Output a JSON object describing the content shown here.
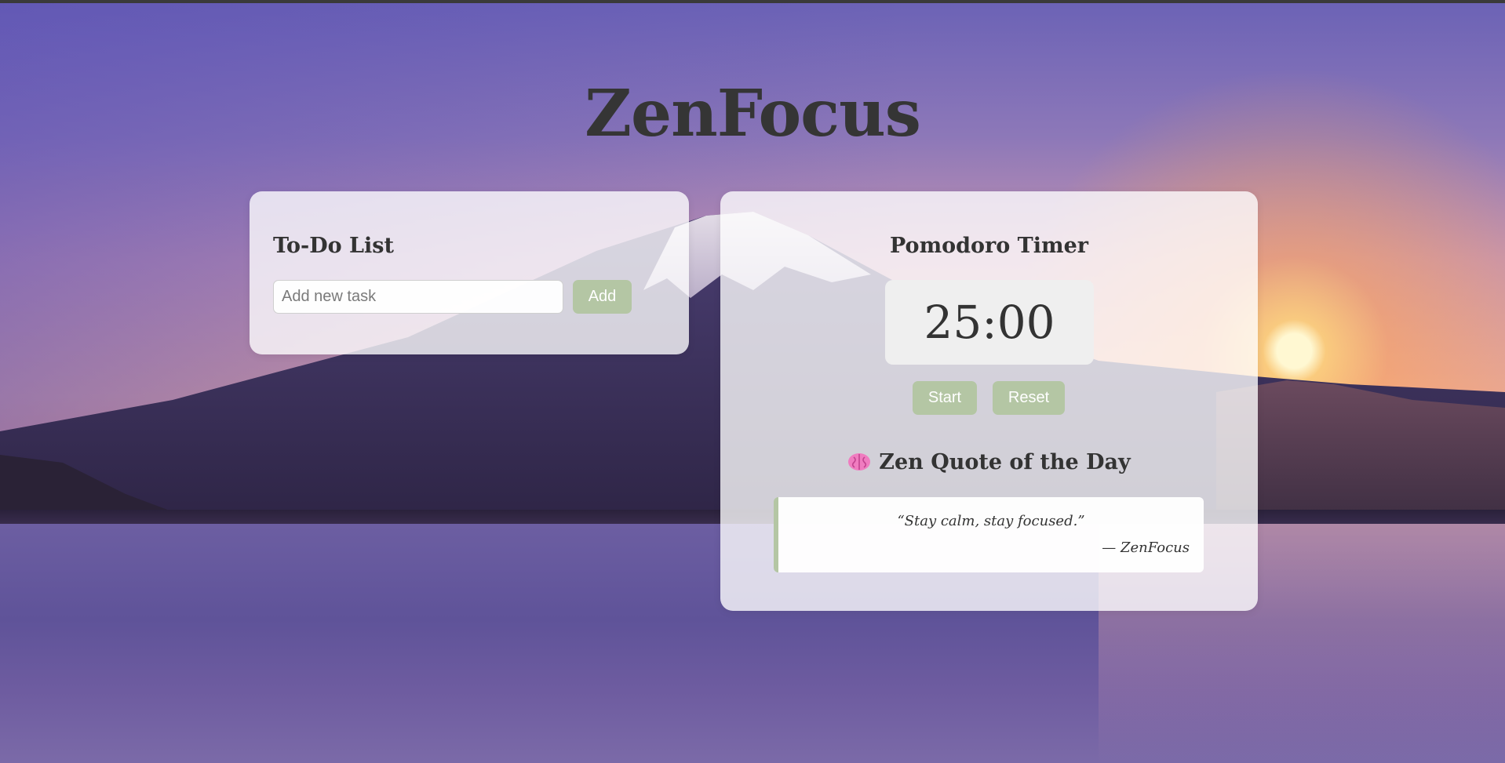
{
  "app": {
    "title": "ZenFocus"
  },
  "todo": {
    "heading": "To-Do List",
    "input_placeholder": "Add new task",
    "input_value": "",
    "add_label": "Add"
  },
  "timer": {
    "heading": "Pomodoro Timer",
    "display": "25:00",
    "start_label": "Start",
    "reset_label": "Reset"
  },
  "quote": {
    "heading": "Zen Quote of the Day",
    "icon": "brain-icon",
    "text": "“Stay calm, stay focused.”",
    "author": "— ZenFocus"
  },
  "colors": {
    "accent": "#b4c6a4",
    "title_text": "#353535",
    "card_bg": "#ffffff"
  }
}
